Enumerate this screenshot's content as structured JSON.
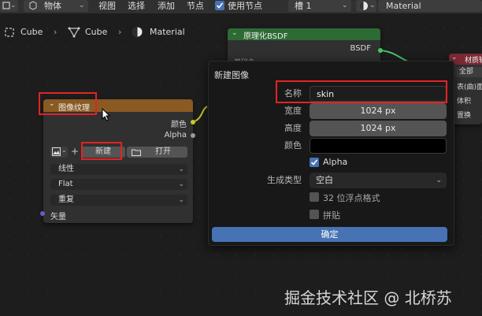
{
  "toolbar": {
    "object_mode": "物体",
    "menu": [
      "视图",
      "选择",
      "添加",
      "节点"
    ],
    "use_nodes_label": "使用节点",
    "slot": "槽 1",
    "material_name": "Material"
  },
  "breadcrumb": {
    "object": "Cube",
    "mesh": "Cube",
    "material": "Material"
  },
  "bsdf_node": {
    "title": "原理化BSDF",
    "output": "BSDF",
    "peek": "基础色"
  },
  "material_output_node": {
    "title": "材质输出",
    "items": [
      "全部",
      "表(曲)面",
      "体积",
      "置换"
    ]
  },
  "image_node": {
    "title": "图像纹理",
    "output_color": "颜色",
    "output_alpha": "Alpha",
    "plus": "+",
    "new_label": "新建",
    "open_label": "打开",
    "interpolation": "线性",
    "projection": "Flat",
    "extension": "重复",
    "vector_label": "矢量"
  },
  "new_image_dialog": {
    "title": "新建图像",
    "name_label": "名称",
    "name_value": "skin",
    "width_label": "宽度",
    "width_value": "1024 px",
    "height_label": "高度",
    "height_value": "1024 px",
    "color_label": "颜色",
    "color_value": "#000000",
    "alpha_label": "Alpha",
    "alpha_checked": true,
    "gen_type_label": "生成类型",
    "gen_type_value": "空白",
    "float_label": "32 位浮点格式",
    "tiled_label": "拼贴",
    "ok_label": "确定"
  },
  "watermark": "掘金技术社区 @ 北桥苏",
  "colors": {
    "accent_blue": "#4772b3",
    "highlight_red": "#e02424",
    "node_header_orange": "#8a5a22",
    "node_header_green": "#2c6b34",
    "node_header_red": "#7a2a32"
  },
  "icons": [
    "object-icon",
    "mesh-icon",
    "material-sphere-icon",
    "image-icon",
    "folder-icon",
    "checkbox-icon",
    "mouse-cursor-icon"
  ]
}
